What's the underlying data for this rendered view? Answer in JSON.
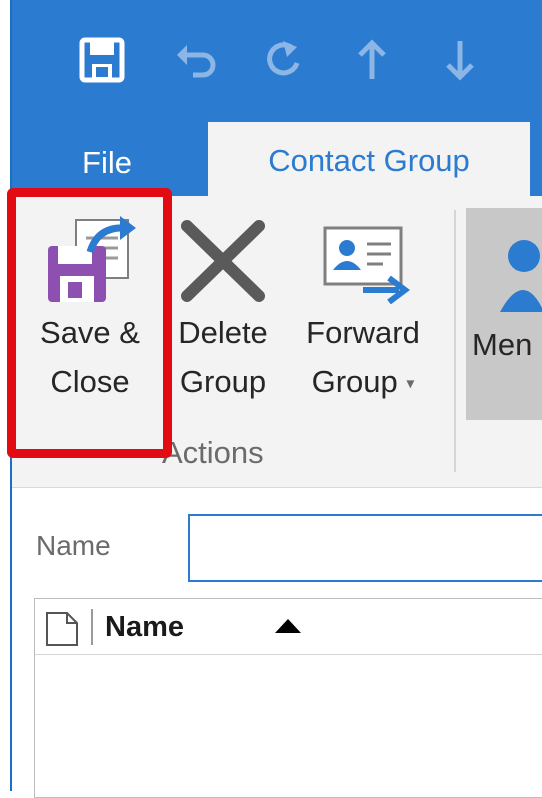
{
  "quick_access": {
    "icons": [
      "save-icon",
      "undo-icon",
      "redo-icon",
      "up-arrow-icon",
      "down-arrow-icon"
    ]
  },
  "tabs": {
    "file": "File",
    "contact_group": "Contact Group"
  },
  "ribbon": {
    "save_close_line1": "Save &",
    "save_close_line2": "Close",
    "delete_group_line1": "Delete",
    "delete_group_line2": "Group",
    "forward_group_line1": "Forward",
    "forward_group_line2": "Group",
    "actions_group_label": "Actions",
    "members_label": "Men"
  },
  "form": {
    "name_label": "Name",
    "name_value": ""
  },
  "list": {
    "column_name": "Name"
  },
  "colors": {
    "accent": "#2b7bd0",
    "highlight": "#e20a13",
    "ribbon_bg": "#f3f3f3"
  }
}
